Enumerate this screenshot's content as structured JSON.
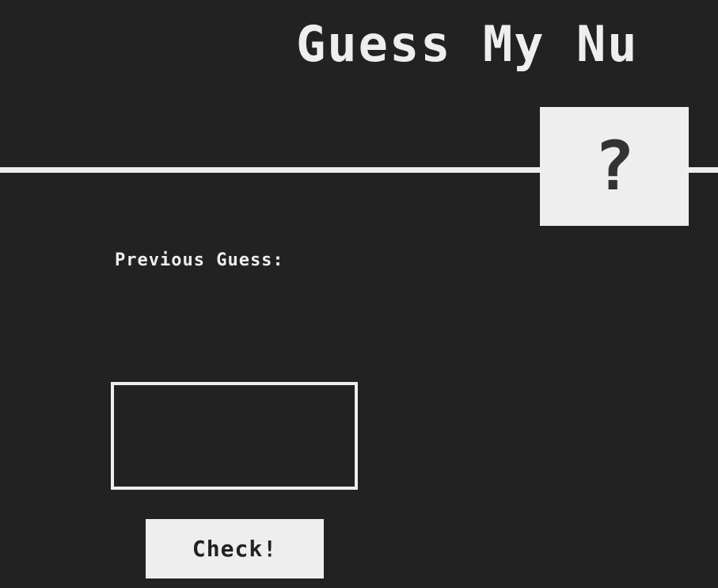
{
  "header": {
    "title": "Guess My Nu"
  },
  "secret_number": {
    "display": "?"
  },
  "previous_guess": {
    "label": "Previous Guess:"
  },
  "guess_input": {
    "value": ""
  },
  "check_button": {
    "label": "Check!"
  },
  "colors": {
    "background": "#222222",
    "foreground": "#eeeeee",
    "accent_text": "#333333"
  }
}
